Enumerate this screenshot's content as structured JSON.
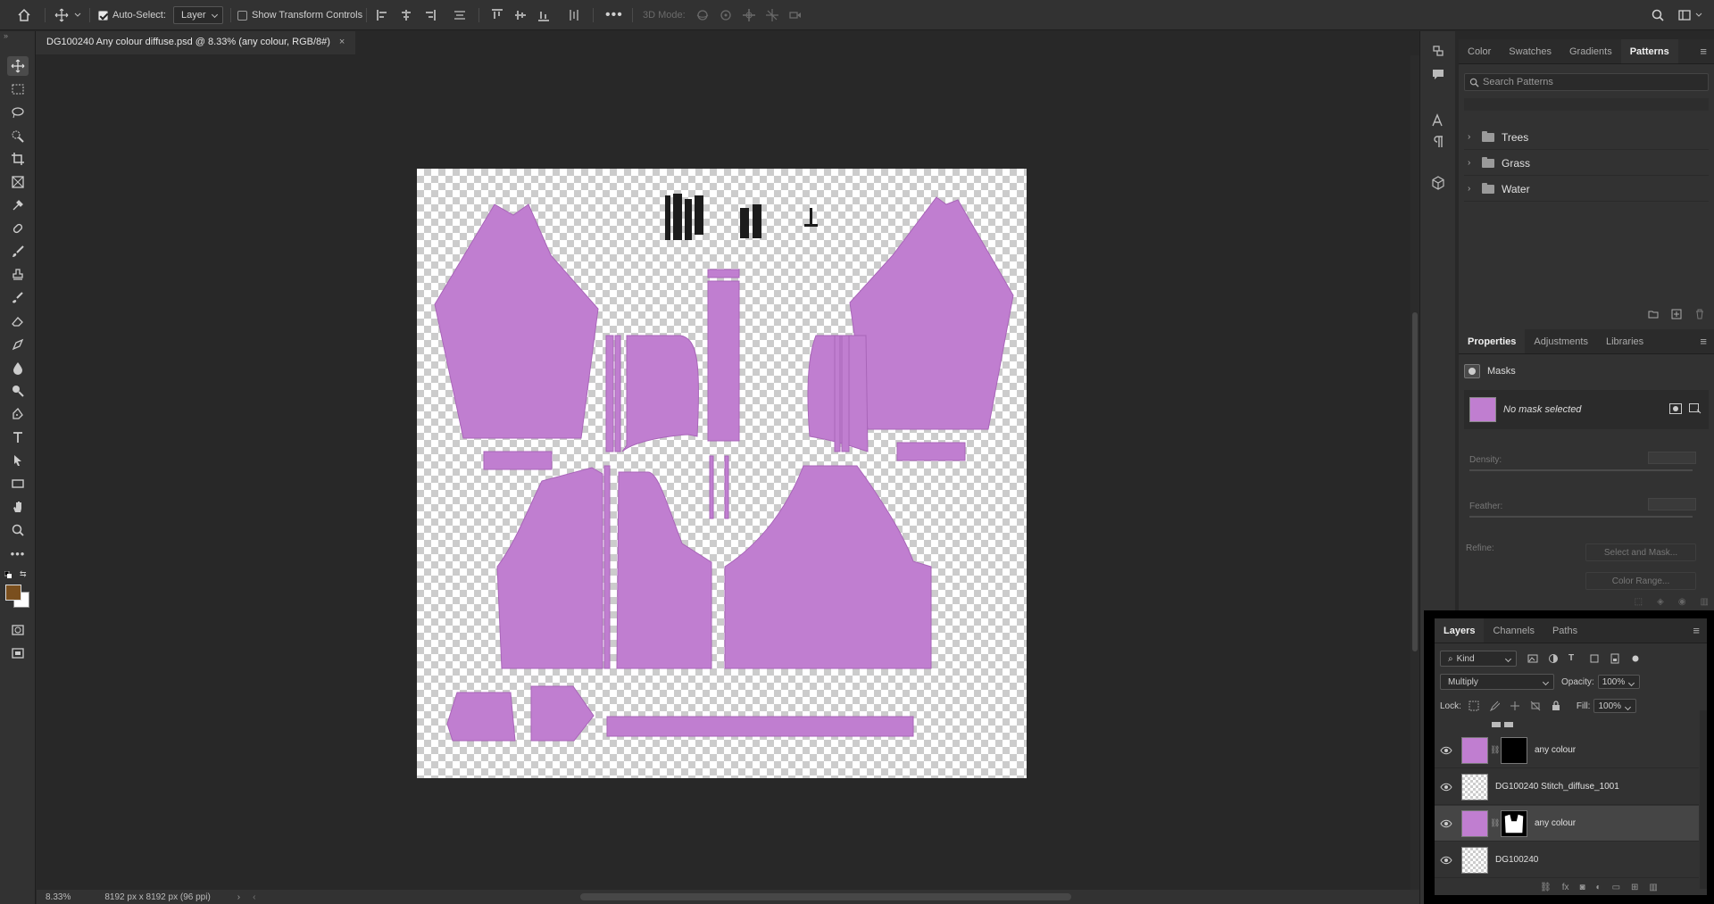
{
  "options_bar": {
    "auto_select_label": "Auto-Select:",
    "auto_select_checked": true,
    "auto_select_target": "Layer",
    "show_transform_label": "Show Transform Controls",
    "mode_3d_label": "3D Mode:"
  },
  "document": {
    "tab_title": "DG100240 Any colour diffuse.psd @ 8.33% (any colour, RGB/8#)",
    "close_glyph": "×",
    "zoom": "8.33%",
    "doc_size": "8192 px x 8192 px (96 ppi)",
    "fill_color": "#c07ed0"
  },
  "colors": {
    "foreground": "#7a4f1e",
    "background": "#ffffff",
    "accent": "#c07ed0"
  },
  "patterns_panel": {
    "tabs": [
      "Color",
      "Swatches",
      "Gradients",
      "Patterns"
    ],
    "active_tab": "Patterns",
    "search_placeholder": "Search Patterns",
    "groups": [
      "Trees",
      "Grass",
      "Water"
    ]
  },
  "properties_panel": {
    "tabs": [
      "Properties",
      "Adjustments",
      "Libraries"
    ],
    "active_tab": "Properties",
    "section": "Masks",
    "mask_status": "No mask selected",
    "density_label": "Density:",
    "feather_label": "Feather:",
    "refine_label": "Refine:",
    "select_mask_button": "Select and Mask...",
    "color_range_button": "Color Range..."
  },
  "layers_panel": {
    "tabs": [
      "Layers",
      "Channels",
      "Paths"
    ],
    "active_tab": "Layers",
    "filter_kind": "Kind",
    "blend_mode": "Multiply",
    "opacity_label": "Opacity:",
    "opacity_value": "100%",
    "lock_label": "Lock:",
    "fill_label": "Fill:",
    "fill_value": "100%",
    "layers": [
      {
        "name": "any colour",
        "thumb": "pink",
        "mask": "black",
        "selected": false
      },
      {
        "name": "DG100240 Stitch_diffuse_1001",
        "thumb": "checker",
        "mask": "",
        "selected": false
      },
      {
        "name": "any colour",
        "thumb": "pink",
        "mask": "white",
        "selected": true
      },
      {
        "name": "DG100240",
        "thumb": "checker",
        "mask": "",
        "selected": false
      }
    ]
  },
  "tools": [
    "move-tool",
    "marquee-tool",
    "lasso-tool",
    "quick-select-tool",
    "crop-tool",
    "frame-tool",
    "eyedropper-tool",
    "healing-tool",
    "brush-tool",
    "stamp-tool",
    "history-brush-tool",
    "eraser-tool",
    "gradient-tool",
    "blur-tool",
    "dodge-tool",
    "pen-tool",
    "type-tool",
    "path-select-tool",
    "shape-tool",
    "hand-tool",
    "zoom-tool",
    "more-tools"
  ]
}
